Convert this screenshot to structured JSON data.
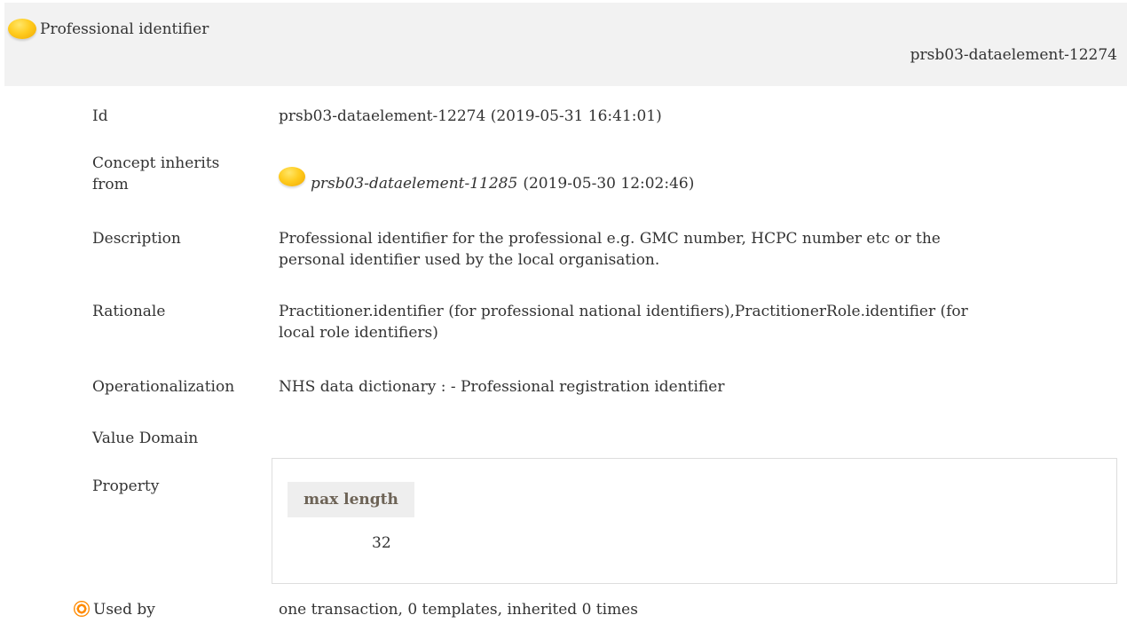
{
  "header": {
    "title": "Professional identifier",
    "id": "prsb03-dataelement-12274"
  },
  "rows": {
    "id": {
      "label": "Id",
      "value": "prsb03-dataelement-12274 (2019-05-31 16:41:01)"
    },
    "inherits": {
      "label_line1": "Concept inherits",
      "label_line2": "from",
      "link": "prsb03-dataelement-11285",
      "date": "(2019-05-30 12:02:46)"
    },
    "description": {
      "label": "Description",
      "line1": "Professional identifier for the professional e.g. GMC number, HCPC number etc or the",
      "line2": "personal identifier used by the local organisation."
    },
    "rationale": {
      "label": "Rationale",
      "line1": "Practitioner.identifier (for professional national identifiers),PractitionerRole.identifier (for",
      "line2": "local role identifiers)"
    },
    "operationalization": {
      "label": "Operationalization",
      "value": "NHS data dictionary : - Professional registration identifier"
    },
    "value_domain": {
      "label": "Value Domain"
    },
    "property": {
      "label": "Property",
      "column_header": "max length",
      "column_value": "32"
    },
    "used_by": {
      "label": "Used by",
      "value": "one transaction, 0 templates, inherited 0 times"
    }
  },
  "colors": {
    "header_bg": "#f2f2f2",
    "status_dot": "#ffcc1f",
    "used_by_icon": "#ff8a00",
    "prop_header_text": "#6d6356"
  },
  "icons": {
    "status": "status-dot-icon",
    "used_by": "target-icon"
  }
}
